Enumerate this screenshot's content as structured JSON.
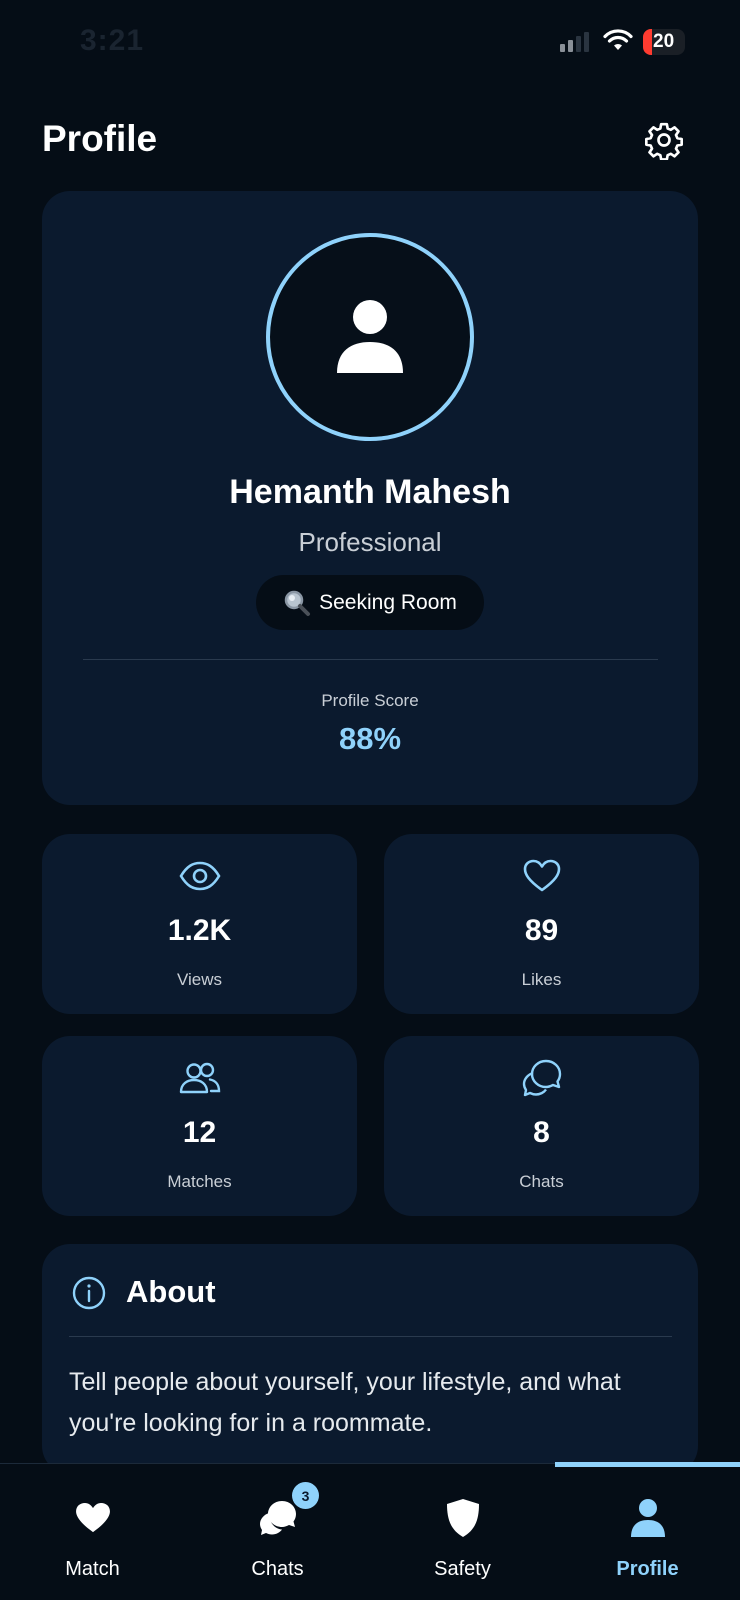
{
  "status_bar": {
    "time": "3:21",
    "battery": "20"
  },
  "header": {
    "title": "Profile",
    "settings_icon": "gear-icon"
  },
  "profile": {
    "avatar_icon": "user-icon",
    "name": "Hemanth Mahesh",
    "role": "Professional",
    "status_icon": "magnifying-glass-icon",
    "status": "Seeking Room",
    "score_label": "Profile Score",
    "score_value": "88%"
  },
  "stats": [
    {
      "icon": "eye-icon",
      "value": "1.2K",
      "label": "Views"
    },
    {
      "icon": "heart-outline-icon",
      "value": "89",
      "label": "Likes"
    },
    {
      "icon": "users-icon",
      "value": "12",
      "label": "Matches"
    },
    {
      "icon": "chat-bubbles-icon",
      "value": "8",
      "label": "Chats"
    }
  ],
  "about": {
    "icon": "info-icon",
    "title": "About",
    "text": "Tell people about yourself, your lifestyle, and what you're looking for in a roommate."
  },
  "nav": {
    "items": [
      {
        "label": "Match",
        "icon": "heart-icon"
      },
      {
        "label": "Chats",
        "icon": "chat-icon",
        "badge": "3"
      },
      {
        "label": "Safety",
        "icon": "shield-icon"
      },
      {
        "label": "Profile",
        "icon": "user-icon"
      }
    ],
    "active": "Profile"
  },
  "colors": {
    "accent": "#8fd2fb",
    "background": "#050d16",
    "card": "#0b1a2e"
  }
}
